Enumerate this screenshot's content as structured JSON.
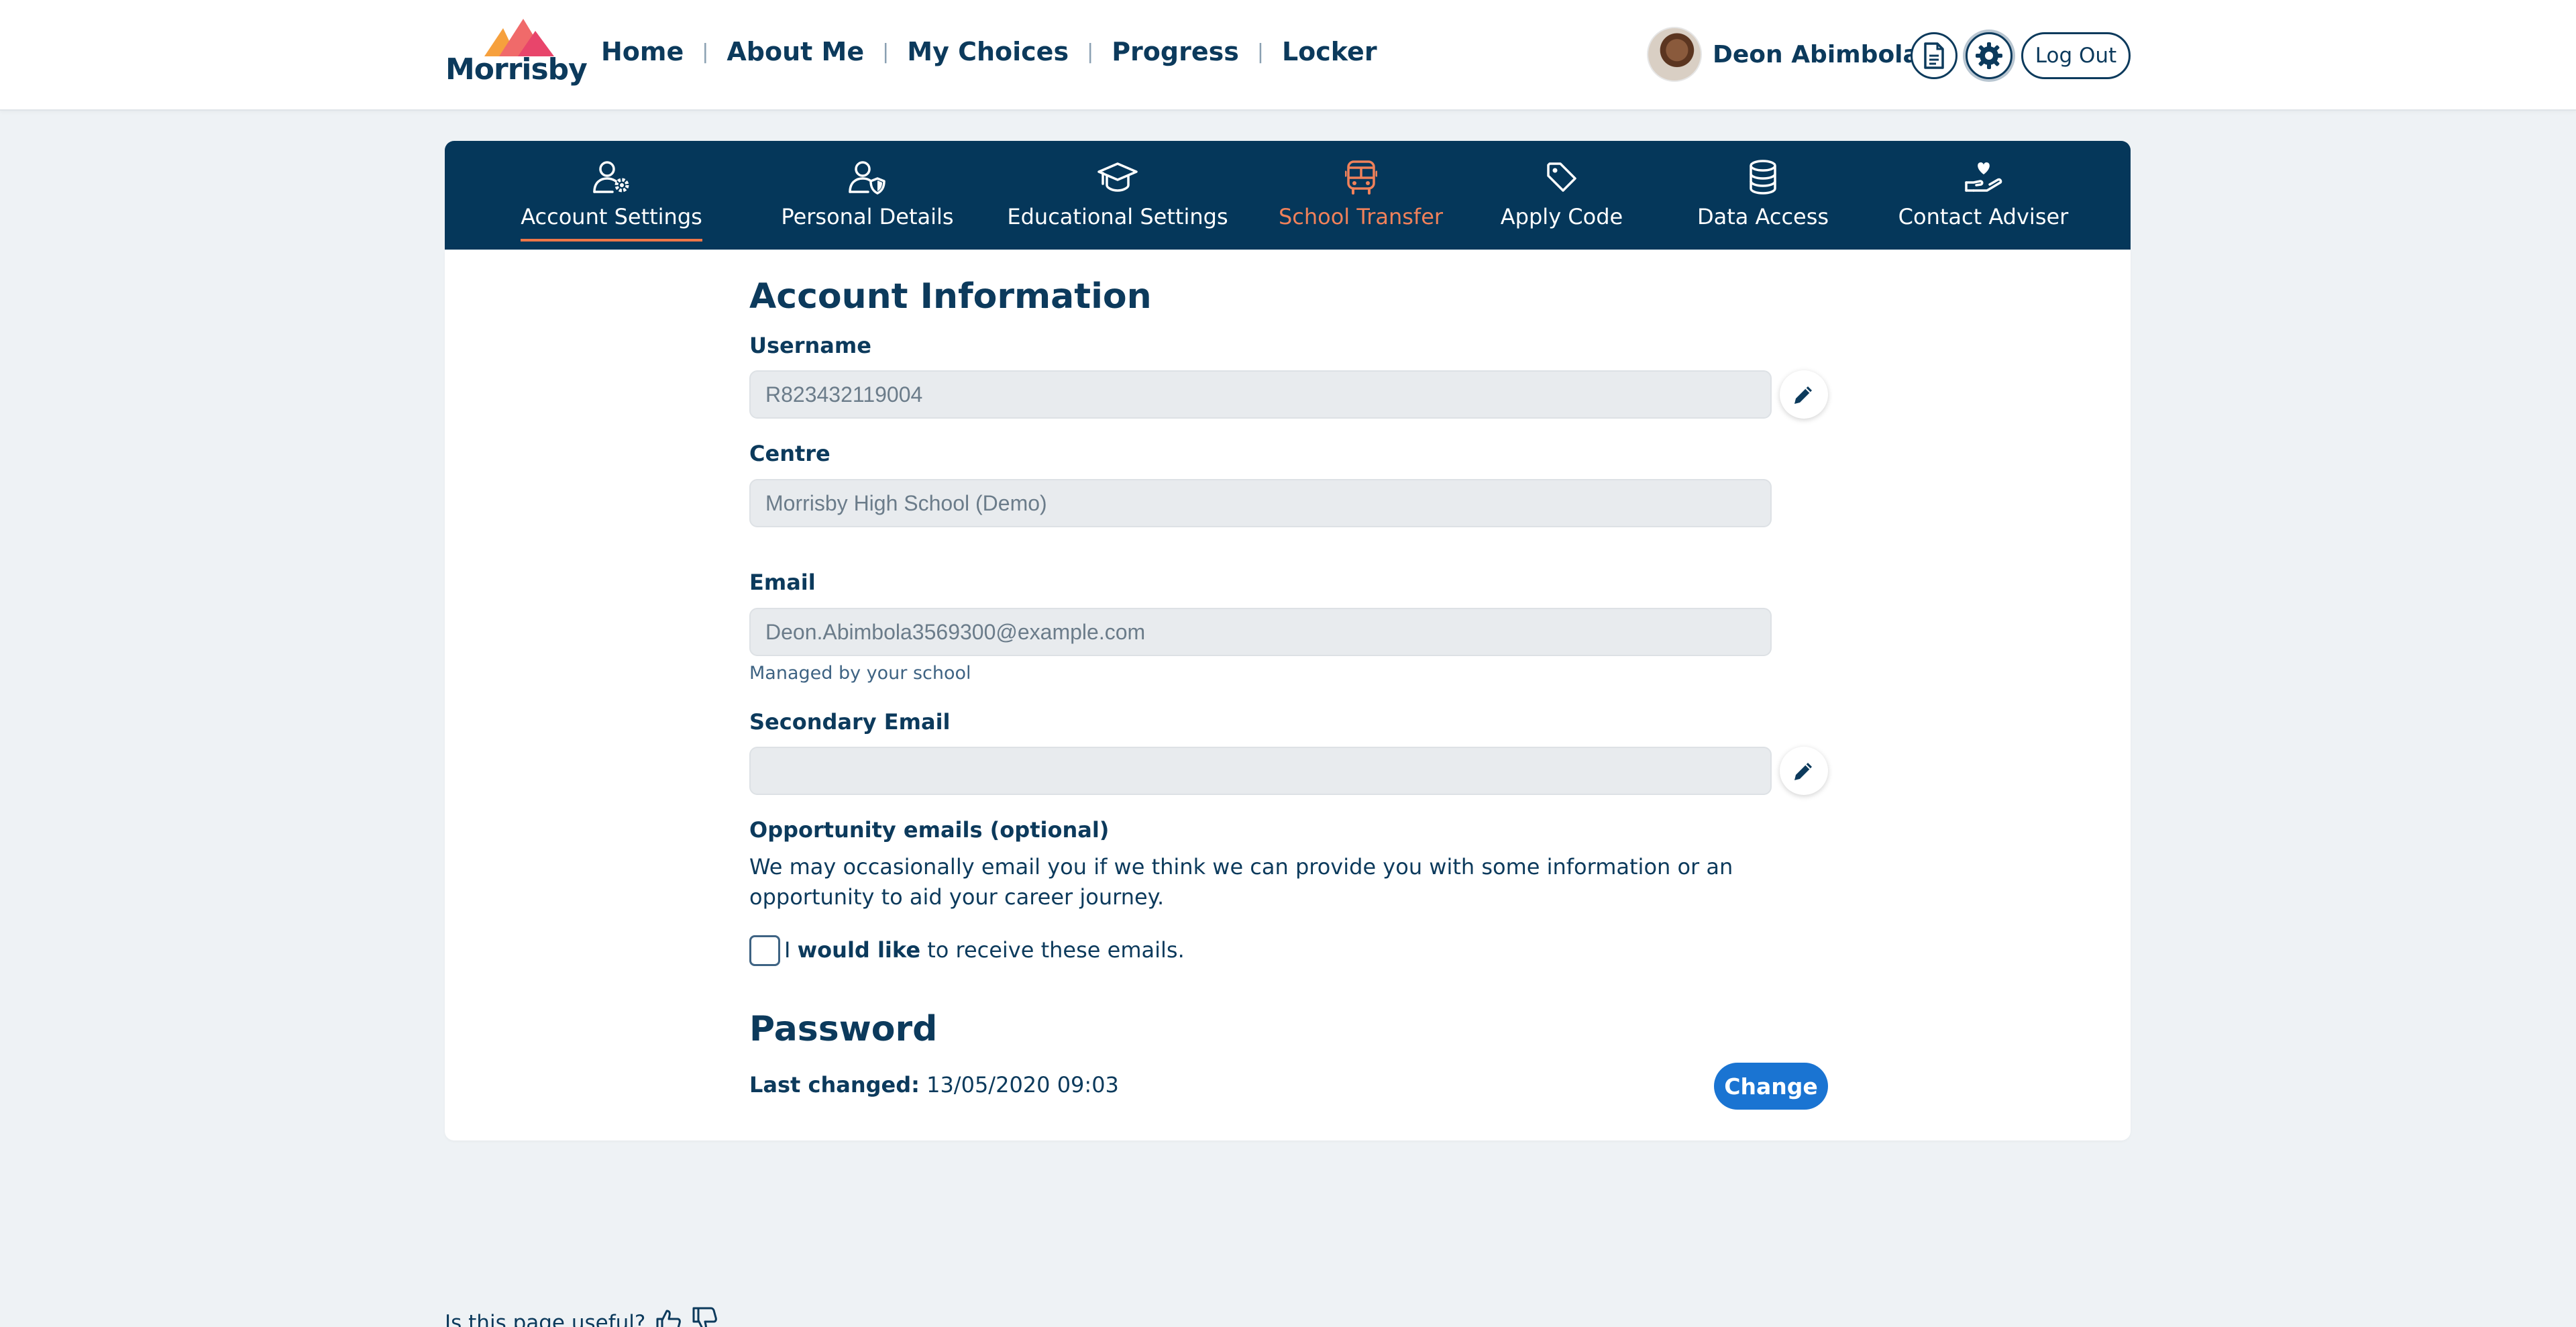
{
  "brand": {
    "logo_text": "Morrisby",
    "colors": {
      "navy": "#05375a",
      "accent_orange": "#ee7648",
      "primary_blue": "#1a74d2"
    }
  },
  "nav": {
    "items": [
      "Home",
      "About Me",
      "My Choices",
      "Progress",
      "Locker"
    ]
  },
  "user": {
    "name": "Deon Abimbola",
    "logout_label": "Log Out",
    "icons": [
      "document-icon",
      "gear-icon"
    ]
  },
  "tabs": [
    {
      "label": "Account Settings",
      "icon": "user-gear-icon",
      "active": true
    },
    {
      "label": "Personal Details",
      "icon": "user-shield-icon"
    },
    {
      "label": "Educational Settings",
      "icon": "graduation-cap-icon"
    },
    {
      "label": "School Transfer",
      "icon": "bus-icon"
    },
    {
      "label": "Apply Code",
      "icon": "tag-icon"
    },
    {
      "label": "Data Access",
      "icon": "database-icon"
    },
    {
      "label": "Contact Adviser",
      "icon": "hand-heart-icon"
    }
  ],
  "account": {
    "heading": "Account Information",
    "username_label": "Username",
    "username_value": "R823432119004",
    "centre_label": "Centre",
    "centre_value": "Morrisby High School (Demo)",
    "email_label": "Email",
    "email_value": "Deon.Abimbola3569300@example.com",
    "email_hint": "Managed by your school",
    "secondary_email_label": "Secondary Email",
    "secondary_email_value": "",
    "opportunity_label": "Opportunity emails (optional)",
    "opportunity_text": "We may occasionally email you if we think we can provide you with some information or an opportunity to aid your career journey.",
    "checkbox_prefix": "I",
    "checkbox_bold": "would like",
    "checkbox_suffix": "to receive these emails.",
    "checkbox_checked": false
  },
  "password": {
    "heading": "Password",
    "last_changed_label": "Last changed:",
    "last_changed_value": "13/05/2020 09:03",
    "change_label": "Change"
  },
  "footer": {
    "useful_text": "Is this page useful?"
  }
}
